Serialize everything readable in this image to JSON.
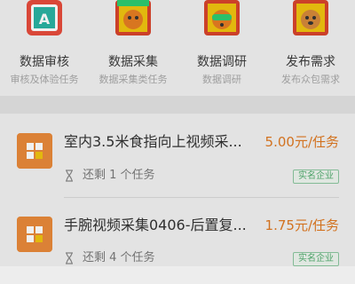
{
  "categories": [
    {
      "title": "数据审核",
      "subtitle": "审核及体验任务",
      "icon": "review-a-icon"
    },
    {
      "title": "数据采集",
      "subtitle": "数据采集类任务",
      "icon": "collect-cat-icon"
    },
    {
      "title": "数据调研",
      "subtitle": "数据调研",
      "icon": "survey-tiger-icon"
    },
    {
      "title": "发布需求",
      "subtitle": "发布众包需求",
      "icon": "publish-dog-icon"
    }
  ],
  "tasks": [
    {
      "title": "室内3.5米食指向上视频采...",
      "price": "5.00元/任务",
      "remaining": "还剩 1 个任务",
      "badge": "实名企业"
    },
    {
      "title": "手腕视频采集0406-后置复...",
      "price": "1.75元/任务",
      "remaining": "还剩 4 个任务",
      "badge": "实名企业"
    }
  ],
  "colors": {
    "accent": "#e07a22",
    "badge_green": "#52ad6f",
    "icon_orange": "#e98a3a"
  }
}
